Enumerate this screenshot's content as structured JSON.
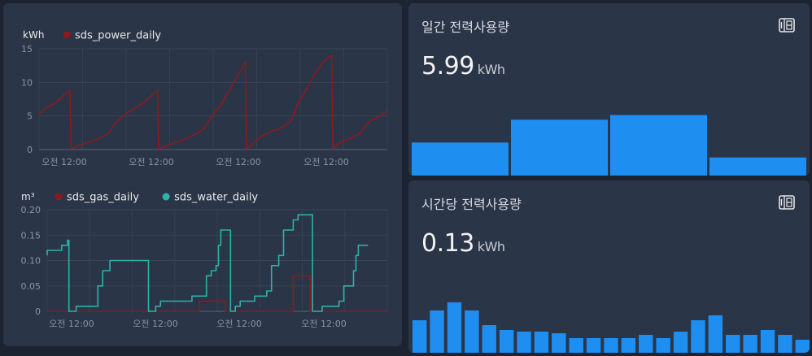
{
  "history": {
    "power": {
      "unit": "kWh",
      "legend": [
        {
          "name": "sds_power_daily",
          "color": "#8b1a1f"
        }
      ],
      "y_ticks": [
        "15",
        "10",
        "5",
        "0"
      ],
      "x_ticks": [
        "오전 12:00",
        "오전 12:00",
        "오전 12:00",
        "오전 12:00"
      ]
    },
    "gas_water": {
      "unit": "m³",
      "legend": [
        {
          "name": "sds_gas_daily",
          "color": "#8b1a1f"
        },
        {
          "name": "sds_water_daily",
          "color": "#2bb3a8"
        }
      ],
      "y_ticks": [
        "0.20",
        "0.15",
        "0.10",
        "0.05",
        "0"
      ],
      "x_ticks": [
        "오전 12:00",
        "오전 12:00",
        "오전 12:00",
        "오전 12:00"
      ]
    }
  },
  "chart_data": [
    {
      "type": "line",
      "ylabel": "kWh",
      "ylim": [
        0,
        15
      ],
      "series": [
        {
          "name": "sds_power_daily",
          "color": "#8b1a1f",
          "points": [
            [
              0,
              5.3
            ],
            [
              3,
              6.2
            ],
            [
              7,
              7.0
            ],
            [
              10,
              8.1
            ],
            [
              12.5,
              8.8
            ],
            [
              13,
              0.1
            ],
            [
              16,
              0.6
            ],
            [
              20,
              1.1
            ],
            [
              24,
              1.6
            ],
            [
              28,
              2.4
            ],
            [
              31,
              4.0
            ],
            [
              35,
              5.3
            ],
            [
              39,
              6.2
            ],
            [
              43,
              7.2
            ],
            [
              47,
              8.5
            ],
            [
              48,
              8.8
            ],
            [
              48.4,
              0.1
            ],
            [
              52,
              0.6
            ],
            [
              56,
              1.2
            ],
            [
              60,
              1.7
            ],
            [
              64,
              2.4
            ],
            [
              67,
              3.2
            ],
            [
              70,
              5.0
            ],
            [
              74,
              6.8
            ],
            [
              78,
              9.5
            ],
            [
              82,
              12.0
            ],
            [
              83.5,
              13.0
            ],
            [
              84,
              0.1
            ],
            [
              87,
              1.0
            ],
            [
              90,
              2.0
            ],
            [
              94,
              2.7
            ],
            [
              98,
              3.2
            ],
            [
              102,
              4.2
            ],
            [
              105,
              7.0
            ],
            [
              108,
              8.8
            ],
            [
              112,
              11.5
            ],
            [
              116,
              13.4
            ],
            [
              118.5,
              14.0
            ],
            [
              119,
              0.1
            ],
            [
              122,
              1.1
            ],
            [
              126,
              1.6
            ],
            [
              130,
              2.4
            ],
            [
              134,
              4.3
            ],
            [
              138,
              5.0
            ],
            [
              141,
              5.8
            ]
          ]
        }
      ]
    },
    {
      "type": "line",
      "ylabel": "m³",
      "ylim": [
        0,
        0.2
      ],
      "series": [
        {
          "name": "sds_gas_daily",
          "color": "#8b1a1f",
          "points": [
            [
              0,
              0
            ],
            [
              63,
              0
            ],
            [
              63,
              0.02
            ],
            [
              74,
              0.02
            ],
            [
              74,
              0
            ],
            [
              102,
              0
            ],
            [
              102,
              0.07
            ],
            [
              109,
              0.07
            ],
            [
              109,
              0
            ],
            [
              141,
              0
            ]
          ]
        },
        {
          "name": "sds_water_daily",
          "color": "#2bb3a8",
          "points": [
            [
              0,
              0.11
            ],
            [
              0,
              0.12
            ],
            [
              6,
              0.12
            ],
            [
              6,
              0.13
            ],
            [
              8.5,
              0.13
            ],
            [
              8.5,
              0.14
            ],
            [
              9,
              0.14
            ],
            [
              9,
              0
            ],
            [
              12,
              0
            ],
            [
              12,
              0.01
            ],
            [
              21,
              0.01
            ],
            [
              21,
              0.05
            ],
            [
              23,
              0.05
            ],
            [
              23,
              0.08
            ],
            [
              26,
              0.08
            ],
            [
              26,
              0.1
            ],
            [
              42,
              0.1
            ],
            [
              42,
              0
            ],
            [
              45,
              0
            ],
            [
              45,
              0.01
            ],
            [
              47,
              0.01
            ],
            [
              47,
              0.02
            ],
            [
              60,
              0.02
            ],
            [
              60,
              0.03
            ],
            [
              66,
              0.03
            ],
            [
              66,
              0.07
            ],
            [
              68,
              0.07
            ],
            [
              68,
              0.08
            ],
            [
              70,
              0.08
            ],
            [
              70,
              0.09
            ],
            [
              71,
              0.09
            ],
            [
              71,
              0.13
            ],
            [
              72,
              0.13
            ],
            [
              72,
              0.16
            ],
            [
              76,
              0.16
            ],
            [
              76,
              0
            ],
            [
              78,
              0
            ],
            [
              78,
              0.01
            ],
            [
              80,
              0.01
            ],
            [
              80,
              0.02
            ],
            [
              86,
              0.02
            ],
            [
              86,
              0.03
            ],
            [
              91,
              0.03
            ],
            [
              91,
              0.04
            ],
            [
              93,
              0.04
            ],
            [
              93,
              0.09
            ],
            [
              96,
              0.09
            ],
            [
              96,
              0.11
            ],
            [
              98,
              0.11
            ],
            [
              98,
              0.16
            ],
            [
              102,
              0.16
            ],
            [
              102,
              0.18
            ],
            [
              104,
              0.18
            ],
            [
              104,
              0.19
            ],
            [
              110,
              0.19
            ],
            [
              110,
              0
            ],
            [
              114,
              0
            ],
            [
              114,
              0.01
            ],
            [
              121,
              0.01
            ],
            [
              121,
              0.02
            ],
            [
              123,
              0.02
            ],
            [
              123,
              0.05
            ],
            [
              127,
              0.05
            ],
            [
              127,
              0.08
            ],
            [
              128,
              0.08
            ],
            [
              128,
              0.11
            ],
            [
              129,
              0.11
            ],
            [
              129,
              0.13
            ],
            [
              133,
              0.13
            ]
          ]
        }
      ]
    },
    {
      "type": "bar",
      "title": "일간 전력사용량",
      "color": "#1f8ef1",
      "values": [
        4.2,
        7.1,
        7.7,
        2.3
      ]
    },
    {
      "type": "bar",
      "title": "시간당 전력사용량",
      "color": "#1f8ef1",
      "values": [
        0.4,
        0.52,
        0.62,
        0.52,
        0.34,
        0.28,
        0.26,
        0.26,
        0.24,
        0.18,
        0.18,
        0.18,
        0.18,
        0.22,
        0.18,
        0.26,
        0.4,
        0.46,
        0.22,
        0.22,
        0.28,
        0.22,
        0.16
      ]
    }
  ],
  "daily": {
    "title": "일간 전력사용량",
    "value": "5.99",
    "unit": "kWh",
    "icon": "meter-icon"
  },
  "hourly": {
    "title": "시간당 전력사용량",
    "value": "0.13",
    "unit": "kWh",
    "icon": "meter-icon"
  }
}
